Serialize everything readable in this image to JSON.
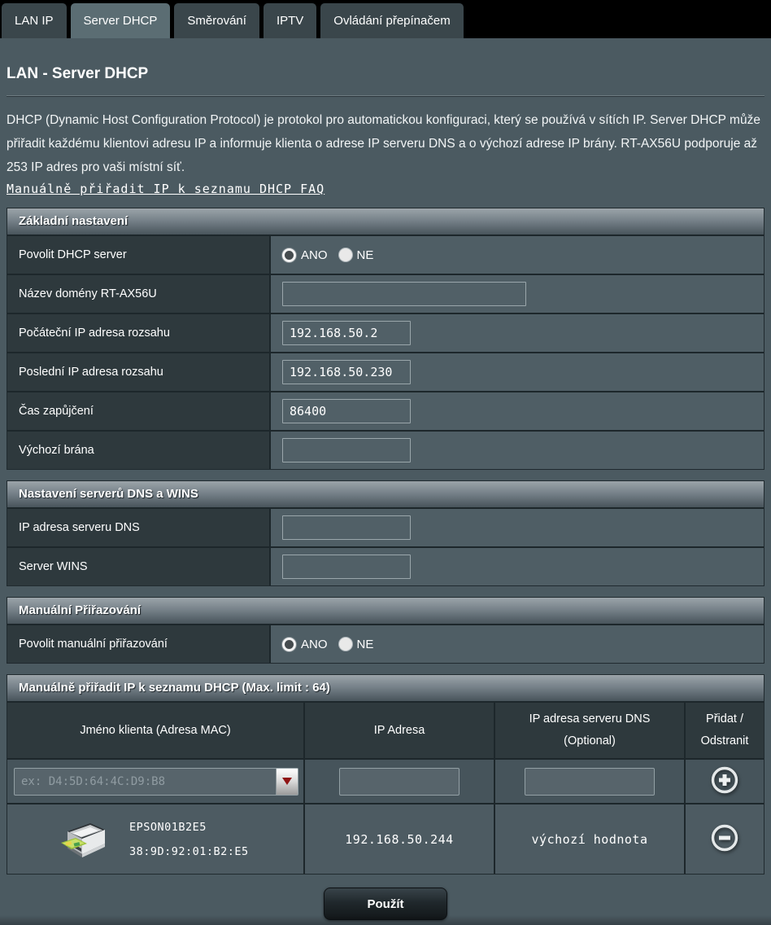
{
  "colors": {
    "page_bg": "#4b5a61",
    "tab_bar_bg": "#000000",
    "tab_active": "#5b6d73",
    "tab_inactive": "#3a464b",
    "label_cell": "#2e393d",
    "value_cell": "#4f5e65",
    "section_header_top": "#9ba4a9",
    "section_header_bottom": "#48545b",
    "dropdown_arrow": "#8f1414"
  },
  "tabs": [
    {
      "label": "LAN IP"
    },
    {
      "label": "Server DHCP"
    },
    {
      "label": "Směrování"
    },
    {
      "label": "IPTV"
    },
    {
      "label": "Ovládání přepínačem"
    }
  ],
  "page": {
    "title": "LAN - Server DHCP",
    "description": "DHCP (Dynamic Host Configuration Protocol) je protokol pro automatickou konfiguraci, který se používá v sítích IP. Server DHCP může přiřadit každému klientovi adresu IP a informuje klienta o adrese IP serveru DNS a o výchozí adrese IP brány. RT-AX56U podporuje až 253 IP adres pro vaši místní síť.",
    "faq_link": "Manuálně přiřadit IP k seznamu DHCP FAQ"
  },
  "basic": {
    "title": "Základní nastavení",
    "enable_label": "Povolit DHCP server",
    "radio_yes": "ANO",
    "radio_no": "NE",
    "enable_selected": "ANO",
    "domain_label": "Název domény RT-AX56U",
    "domain_value": "",
    "ip_start_label": "Počáteční IP adresa rozsahu",
    "ip_start_value": "192.168.50.2",
    "ip_end_label": "Poslední IP adresa rozsahu",
    "ip_end_value": "192.168.50.230",
    "lease_label": "Čas zapůjčení",
    "lease_value": "86400",
    "gateway_label": "Výchozí brána",
    "gateway_value": ""
  },
  "dns_wins": {
    "title": "Nastavení serverů DNS a WINS",
    "dns_label": "IP adresa serveru DNS",
    "dns_value": "",
    "wins_label": "Server WINS",
    "wins_value": ""
  },
  "manual": {
    "title": "Manuální Přiřazování",
    "enable_label": "Povolit manuální přiřazování",
    "radio_yes": "ANO",
    "radio_no": "NE",
    "enable_selected": "ANO"
  },
  "assign": {
    "title": "Manuálně přiřadit IP k seznamu DHCP (Max. limit : 64)",
    "columns": [
      "Jméno klienta (Adresa MAC)",
      "IP Adresa",
      "IP adresa serveru DNS (Optional)",
      "Přidat / Odstranit"
    ],
    "mac_placeholder": "ex: D4:5D:64:4C:D9:B8",
    "new_ip_value": "",
    "new_dns_value": "",
    "client": {
      "name": "EPSON01B2E5",
      "mac": "38:9D:92:01:B2:E5",
      "ip": "192.168.50.244",
      "dns": "výchozí hodnota"
    }
  },
  "apply_label": "Použít"
}
